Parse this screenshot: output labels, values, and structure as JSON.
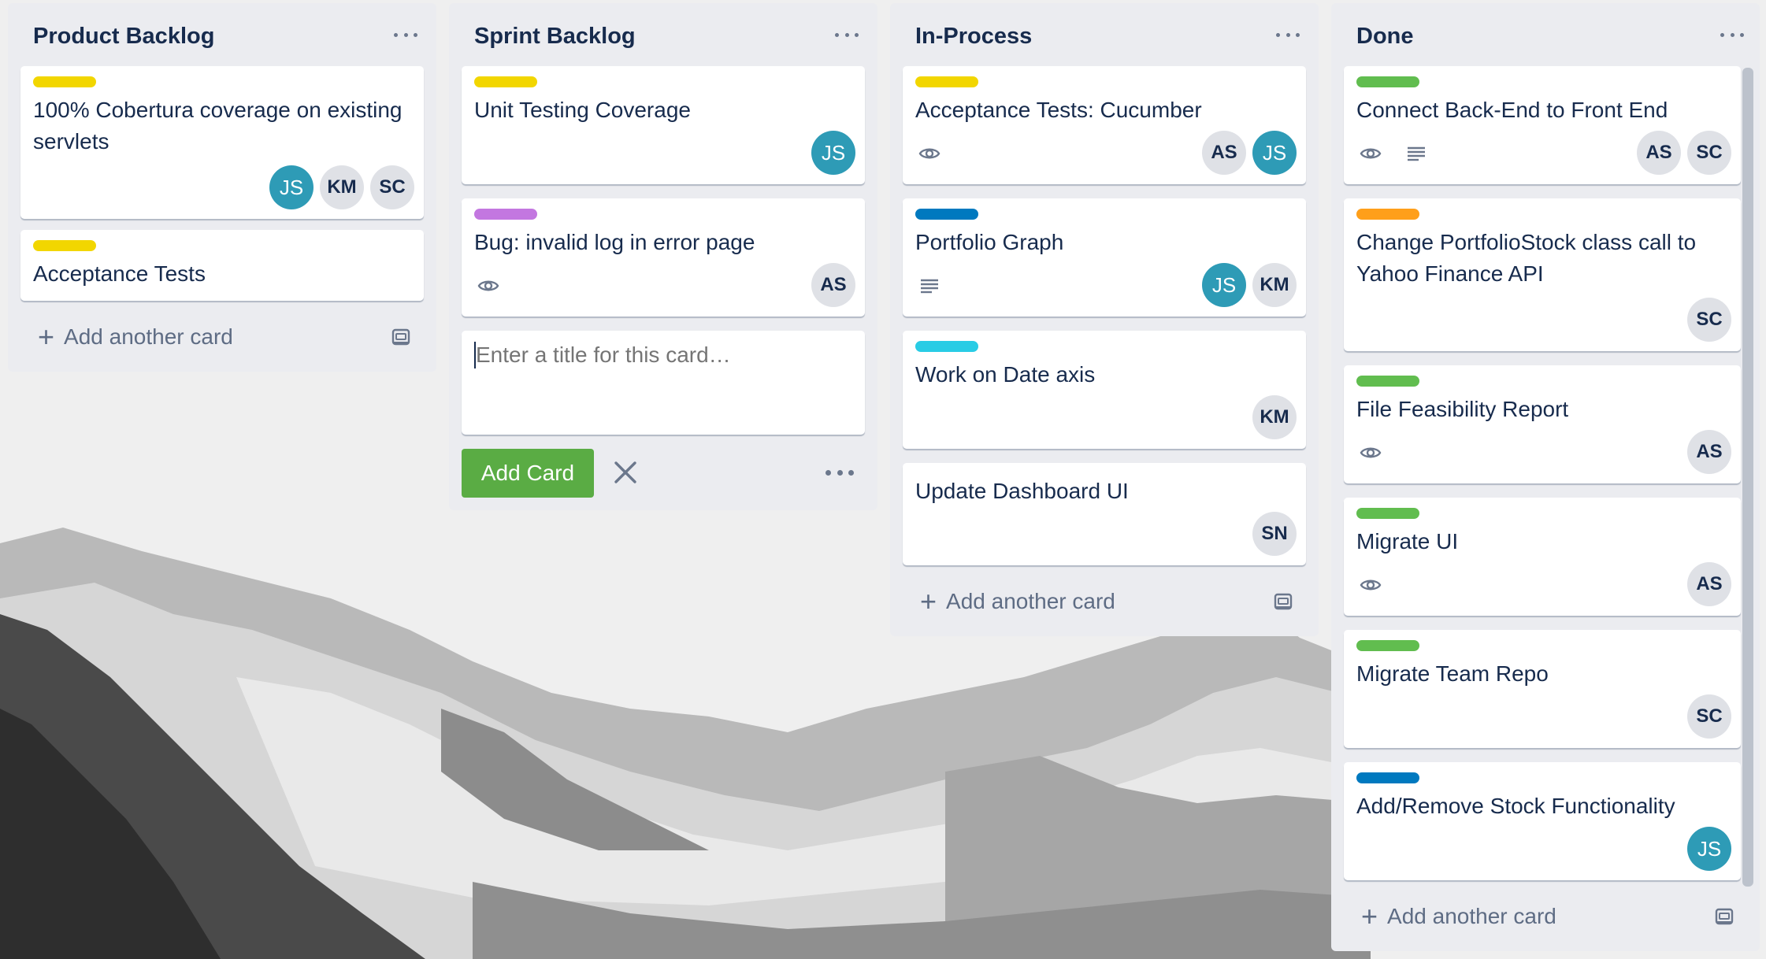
{
  "board": {
    "lists": [
      {
        "title": "Product Backlog",
        "cards": [
          {
            "label_color": "#f2d600",
            "title": "100% Cobertura coverage on existing servlets",
            "members": [
              "JS",
              "KM",
              "SC"
            ]
          },
          {
            "label_color": "#f2d600",
            "title": "Acceptance Tests",
            "members": []
          }
        ],
        "add_card": "Add another card"
      },
      {
        "title": "Sprint Backlog",
        "cards": [
          {
            "label_color": "#f2d600",
            "title": "Unit Testing Coverage",
            "members": [
              "JS"
            ]
          },
          {
            "label_color": "#c377e0",
            "title": "Bug: invalid log in error page",
            "members": [
              "AS"
            ],
            "badges": [
              "watch-icon"
            ]
          }
        ],
        "composer": {
          "placeholder": "Enter a title for this card…",
          "add_button": "Add Card"
        }
      },
      {
        "title": "In-Process",
        "cards": [
          {
            "label_color": "#f2d600",
            "title": "Acceptance Tests: Cucumber",
            "members": [
              "AS",
              "JS"
            ],
            "badges": [
              "watch-icon"
            ]
          },
          {
            "label_color": "#0079bf",
            "title": "Portfolio Graph",
            "members": [
              "JS",
              "KM"
            ],
            "badges": [
              "description-icon"
            ]
          },
          {
            "label_color": "#29cce5",
            "title": "Work on Date axis",
            "members": [
              "KM"
            ]
          },
          {
            "title": "Update Dashboard UI",
            "members": [
              "SN"
            ]
          }
        ],
        "add_card": "Add another card"
      },
      {
        "title": "Done",
        "cards": [
          {
            "label_color": "#61bd4f",
            "title": "Connect Back-End to Front End",
            "members": [
              "AS",
              "SC"
            ],
            "badges": [
              "watch-icon",
              "description-icon"
            ]
          },
          {
            "label_color": "#ff9f1a",
            "title": "Change PortfolioStock class call to Yahoo Finance API",
            "members": [
              "SC"
            ]
          },
          {
            "label_color": "#61bd4f",
            "title": "File Feasibility Report",
            "members": [
              "AS"
            ],
            "badges": [
              "watch-icon"
            ]
          },
          {
            "label_color": "#61bd4f",
            "title": "Migrate UI",
            "members": [
              "AS"
            ],
            "badges": [
              "watch-icon"
            ]
          },
          {
            "label_color": "#61bd4f",
            "title": "Migrate Team Repo",
            "members": [
              "SC"
            ]
          },
          {
            "label_color": "#0079bf",
            "title": "Add/Remove Stock Functionality",
            "members": [
              "JS"
            ]
          }
        ],
        "add_card": "Add another card"
      }
    ]
  }
}
